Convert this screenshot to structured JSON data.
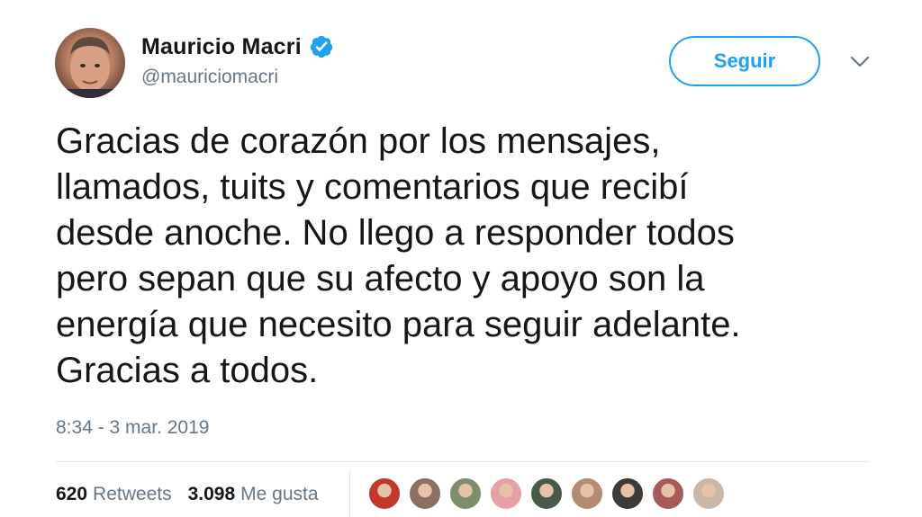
{
  "author": {
    "name": "Mauricio Macri",
    "handle": "@mauriciomacri",
    "verified_icon": "verified-badge-icon",
    "avatar_icon": "profile-photo"
  },
  "follow_button": {
    "label": "Seguir"
  },
  "menu_icon": "chevron-down-icon",
  "tweet": {
    "text": "Gracias de corazón por los mensajes,\nllamados, tuits y comentarios que recibí\ndesde anoche. No llego a responder todos\npero sepan que su afecto y apoyo son la\nenergía que necesito para seguir adelante.\nGracias a todos.",
    "timestamp": "8:34 - 3 mar. 2019"
  },
  "stats": {
    "retweets_count": "620",
    "retweets_label": "Retweets",
    "likes_count": "3.098",
    "likes_label": "Me gusta"
  },
  "colors": {
    "accent": "#1da1f2",
    "text": "#14171a",
    "muted": "#657786",
    "divider": "#e1e8ed"
  },
  "likers": [
    {
      "name": "liker-avatar-1",
      "color": "#c0392b"
    },
    {
      "name": "liker-avatar-2",
      "color": "#8d6e63"
    },
    {
      "name": "liker-avatar-3",
      "color": "#7f8c6d"
    },
    {
      "name": "liker-avatar-4",
      "color": "#e8a0a8"
    },
    {
      "name": "liker-avatar-5",
      "color": "#4a5a4a"
    },
    {
      "name": "liker-avatar-6",
      "color": "#b58a72"
    },
    {
      "name": "liker-avatar-7",
      "color": "#3e3a38"
    },
    {
      "name": "liker-avatar-8",
      "color": "#a85a5a"
    },
    {
      "name": "liker-avatar-9",
      "color": "#c9b8a8"
    }
  ]
}
